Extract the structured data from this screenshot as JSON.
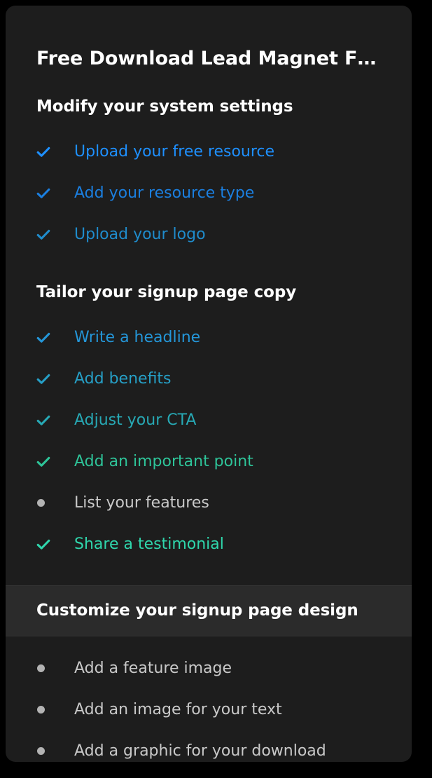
{
  "card": {
    "title": "Free Download Lead Magnet F…",
    "background_color": "#1d1d1d",
    "highlight_band_color": "#2b2b2b",
    "incomplete_color": "#c9c9c9",
    "incomplete_marker_color": "#b3b3b3",
    "header_color": "#ffffff"
  },
  "sections": [
    {
      "header": "Modify your system settings",
      "highlighted": false,
      "items": [
        {
          "label": "Upload your free resource",
          "status": "complete",
          "marker": "check-icon",
          "color": "#1e90ff"
        },
        {
          "label": "Add your resource type",
          "status": "complete",
          "marker": "check-icon",
          "color": "#1b7fe0"
        },
        {
          "label": "Upload your logo",
          "status": "complete",
          "marker": "check-icon",
          "color": "#1f8ccc"
        }
      ]
    },
    {
      "header": "Tailor your signup page copy",
      "highlighted": false,
      "items": [
        {
          "label": "Write a headline",
          "status": "complete",
          "marker": "check-icon",
          "color": "#2496d8"
        },
        {
          "label": "Add benefits",
          "status": "complete",
          "marker": "check-icon",
          "color": "#269fc6"
        },
        {
          "label": "Adjust your CTA",
          "status": "complete",
          "marker": "check-icon",
          "color": "#27a9b5"
        },
        {
          "label": "Add an important point",
          "status": "complete",
          "marker": "check-icon",
          "color": "#2ec499"
        },
        {
          "label": "List your features",
          "status": "incomplete",
          "marker": "dot-icon",
          "color": "#c9c9c9"
        },
        {
          "label": "Share a testimonial",
          "status": "complete",
          "marker": "check-icon",
          "color": "#2fd6ac"
        }
      ]
    },
    {
      "header": "Customize your signup page design",
      "highlighted": true,
      "items": [
        {
          "label": "Add a feature image",
          "status": "incomplete",
          "marker": "dot-icon",
          "color": "#c9c9c9"
        },
        {
          "label": "Add an image for your text",
          "status": "incomplete",
          "marker": "dot-icon",
          "color": "#c9c9c9"
        },
        {
          "label": "Add a graphic for your download",
          "status": "incomplete",
          "marker": "dot-icon",
          "color": "#c9c9c9"
        }
      ]
    }
  ]
}
